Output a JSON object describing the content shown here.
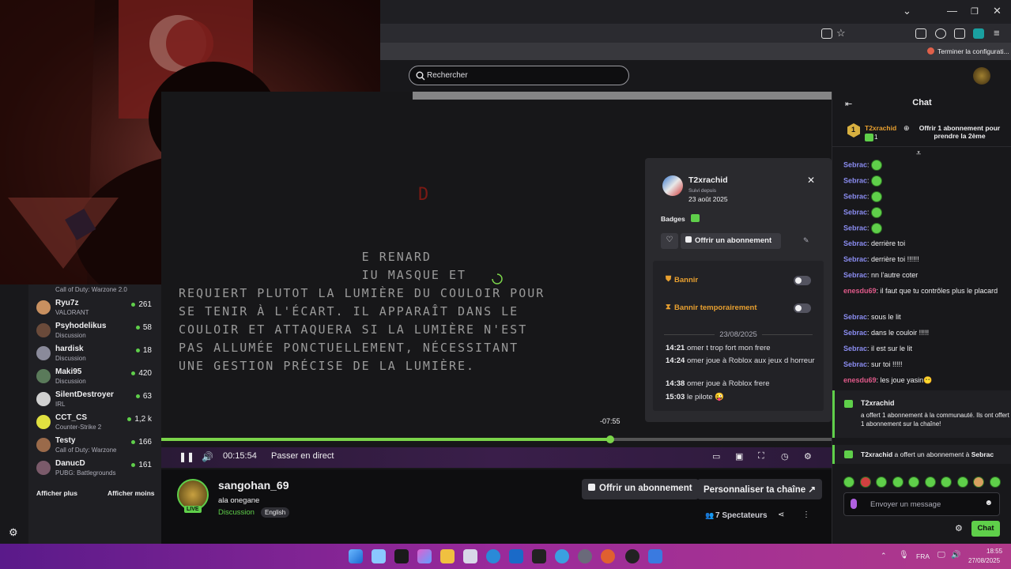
{
  "browser": {
    "bookmark_label": "Terminer la configurati..."
  },
  "topbar": {
    "search_placeholder": "Rechercher"
  },
  "sidebar": {
    "top_game": "Call of Duty: Warzone 2.0",
    "channels": [
      {
        "name": "Ryu7z",
        "game": "VALORANT",
        "viewers": "261"
      },
      {
        "name": "Psyhodelikus",
        "game": "Discussion",
        "viewers": "58"
      },
      {
        "name": "hardisk",
        "game": "Discussion",
        "viewers": "18"
      },
      {
        "name": "Maki95",
        "game": "Discussion",
        "viewers": "420"
      },
      {
        "name": "SilentDestroyer",
        "game": "IRL",
        "viewers": "63"
      },
      {
        "name": "CCT_CS",
        "game": "Counter-Strike 2",
        "viewers": "1,2 k"
      },
      {
        "name": "Testy",
        "game": "Call of Duty: Warzone",
        "viewers": "166"
      },
      {
        "name": "DanucD",
        "game": "PUBG: Battlegrounds",
        "viewers": "161"
      }
    ],
    "show_more": "Afficher plus",
    "show_less": "Afficher moins"
  },
  "player": {
    "overlay_lines": [
      "E RENARD",
      "IU MASQUE ET",
      "REQUIERT PLUTOT LA LUMIÈRE DU COULOIR POUR",
      "SE TENIR À L'ÉCART. IL APPARAÎT DANS LE",
      "COULOIR ET ATTAQUERA SI LA LUMIÈRE N'EST",
      "PAS ALLUMÉE PONCTUELLEMENT, NÉCESSITANT",
      "UNE GESTION PRÉCISE DE LA LUMIÈRE."
    ],
    "hover_time": "-07:55",
    "progress_fraction": 0.67,
    "elapsed": "00:15:54",
    "go_live": "Passer en direct"
  },
  "user_card": {
    "username": "T2xrachid",
    "followed_label": "Suivi depuis",
    "followed_date": "23 août 2025",
    "badges_label": "Badges",
    "gift_button": "Offrir un abonnement",
    "ban_label": "Bannir",
    "timeout_label": "Bannir temporairement",
    "log_date": "23/08/2025",
    "log": [
      {
        "time": "14:21",
        "text": "omer t trop fort mon frere"
      },
      {
        "time": "14:24",
        "text": "omer joue à Roblox aux jeux d horreur"
      },
      {
        "time": "14:38",
        "text": "omer joue à Roblox frere"
      },
      {
        "time": "15:03",
        "text": "le pilote 😜"
      }
    ]
  },
  "channel": {
    "name": "sangohan_69",
    "title": "ala onegane",
    "category": "Discussion",
    "tag": "English",
    "live_badge": "LIVE",
    "gift_button": "Offrir un abonnement",
    "customize_button": "Personnaliser ta chaîne",
    "viewers": "7 Spectateurs"
  },
  "chat": {
    "header": "Chat",
    "pinned_user": "T2xrachid",
    "pinned_count": "1",
    "pinned_cta": "Offrir 1 abonnement pour prendre la 2ème",
    "messages": [
      {
        "user": "Sebrac",
        "text": "",
        "color": "#8a8cf0",
        "emote": true
      },
      {
        "user": "Sebrac",
        "text": "",
        "color": "#8a8cf0",
        "emote": true
      },
      {
        "user": "Sebrac",
        "text": "",
        "color": "#8a8cf0",
        "emote": true
      },
      {
        "user": "Sebrac",
        "text": "",
        "color": "#8a8cf0",
        "emote": true
      },
      {
        "user": "Sebrac",
        "text": "",
        "color": "#8a8cf0",
        "emote": true
      },
      {
        "user": "Sebrac",
        "text": "derrière toi",
        "color": "#8a8cf0"
      },
      {
        "user": "Sebrac",
        "text": "derrière toi !!!!!!",
        "color": "#8a8cf0"
      },
      {
        "user": "Sebrac",
        "text": "nn l'autre coter",
        "color": "#8a8cf0"
      },
      {
        "user": "enesdu69",
        "text": "il faut que tu contrôles plus le placard",
        "color": "#e05a8a"
      },
      {
        "user": "Sebrac",
        "text": "sous le lit",
        "color": "#8a8cf0"
      },
      {
        "user": "Sebrac",
        "text": "dans le couloir !!!!!",
        "color": "#8a8cf0"
      },
      {
        "user": "Sebrac",
        "text": "il est sur le lit",
        "color": "#8a8cf0"
      },
      {
        "user": "Sebrac",
        "text": "sur toi !!!!!",
        "color": "#8a8cf0"
      },
      {
        "user": "enesdu69",
        "text": "les joue yasin😶",
        "color": "#e05a8a"
      }
    ],
    "sub_user": "T2xrachid",
    "sub_text": "a offert 1 abonnement à la communauté. Ils ont offert 1 abonnement sur la chaîne!",
    "gift_line_user": "T2xrachid",
    "gift_line_text": "a offert un abonnement à",
    "gift_line_target": "Sebrac",
    "input_placeholder": "Envoyer un message",
    "send_button": "Chat"
  },
  "taskbar": {
    "lang": "FRA",
    "time": "18:55",
    "date": "27/08/2025"
  },
  "colors": {
    "accent_green": "#5fcf4a",
    "twitch_bg": "#0e0e10",
    "panel_bg": "#18181b"
  }
}
